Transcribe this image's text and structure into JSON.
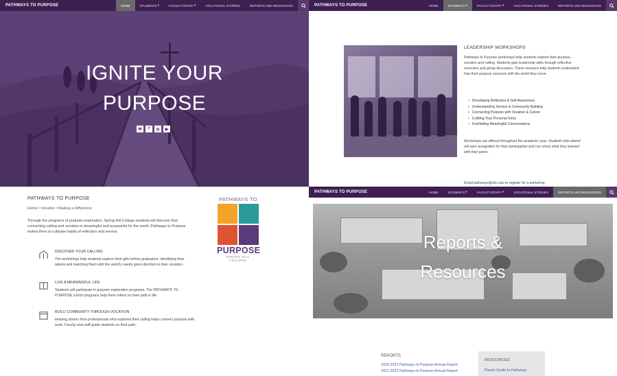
{
  "brand": "PATHWAYS TO PURPOSE",
  "hero": {
    "nav_items": [
      "HOME",
      "STUDENTS",
      "FACULTY/STAFF",
      "VOCATIONAL STORIES",
      "REPORTS AND RESOURCES"
    ],
    "title_line1": "IGNITE YOUR",
    "title_line2": "PURPOSE",
    "social_icons": [
      "envelope-icon",
      "facebook-icon",
      "instagram-icon",
      "youtube-icon"
    ]
  },
  "about": {
    "heading": "PATHWAYS TO PURPOSE",
    "subheading": "Home / Vocation / Making a Difference",
    "paragraph": "Through the programs of purpose-exploration, Spring Hill College students will discover that connecting calling and vocation is meaningful and purposeful for the world. Pathways to Purpose invites them to cultivate habits of reflection and service.",
    "features": [
      {
        "icon": "compass-icon",
        "title": "DISCOVER YOUR CALLING",
        "desc": "The workshops help students explore their gifts before graduation. Identifying their talents and matching them with the world's needs gives direction to their vocation."
      },
      {
        "icon": "book-icon",
        "title": "LIVE A MEANINGFUL LIFE",
        "desc": "Students will participate in purpose exploration programs. The PATHWAYS TO PURPOSE cohort programs help them reflect on their path in life."
      },
      {
        "icon": "calendar-icon",
        "title": "BUILD COMMUNITY THROUGH VOCATION",
        "desc": "Hearing stories from professionals who explored their calling helps connect purpose with work. Faculty and staff guide students on their path."
      }
    ],
    "logo": {
      "top": "PATHWAYS TO",
      "bottom": "PURPOSE",
      "tag": "SPRING HILL COLLEGE"
    }
  },
  "leadership": {
    "nav_items": [
      "HOME",
      "STUDENTS",
      "FACULTY/STAFF",
      "VOCATIONAL STORIES",
      "REPORTS AND RESOURCES"
    ],
    "active_nav": "STUDENTS",
    "heading": "LEADERSHIP WORKSHOPS",
    "paragraph": "Pathways to Purpose workshops help students explore their purpose, vocation and calling. Students gain leadership skills through reflective exercises and group discussion. These sessions help students understand how their purpose connects with the world they serve.",
    "bullets": [
      "Developing Reflection & Self-Awareness",
      "Understanding Service & Community Building",
      "Connecting Purpose with Vocation & Career",
      "Crafting Your Personal Story",
      "Facilitating Meaningful Conversations"
    ],
    "paragraph2": "Workshops are offered throughout the academic year. Students who attend will earn recognition for their participation and can share what they learned with their peers.",
    "footer_line": "Email pathways@shc.edu to register for a workshop."
  },
  "reports": {
    "nav_items": [
      "HOME",
      "STUDENTS",
      "FACULTY/STAFF",
      "VOCATIONAL STORIES",
      "REPORTS AND RESOURCES"
    ],
    "active_nav": "REPORTS AND RESOURCES",
    "title_line1": "Reports &",
    "title_line2": "Resources",
    "reports_heading": "REPORTS",
    "report_links": [
      "2020-2021 Pathways to Purpose Annual Report",
      "2021-2022 Pathways to Purpose Annual Report"
    ],
    "resources_heading": "RESOURCES",
    "resource_link": "Parent Guide to Pathways"
  }
}
